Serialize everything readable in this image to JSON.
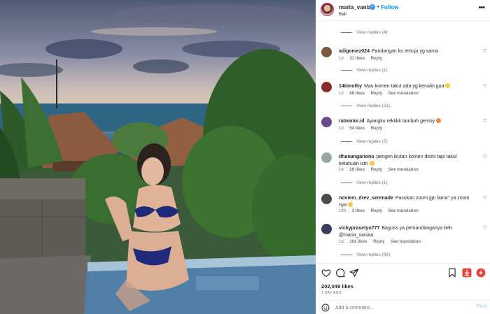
{
  "header": {
    "username": "maria_vaniaa",
    "follow_label": "Follow",
    "location": "Bali",
    "dot": "•",
    "more": "•••"
  },
  "comments": {
    "top_view_replies": "View replies (4)",
    "items": [
      {
        "user": "adigomez024",
        "text": "Pandangan ku tertuju yg sama",
        "time": "1d",
        "likes": "31 likes",
        "reply": "Reply",
        "translate": "",
        "view_replies": "View replies (1)",
        "avatar_color": "#7a5a3c"
      },
      {
        "user": "14timothy",
        "text": "Mau komen takut ada yg kenalin gua",
        "time": "1d",
        "likes": "68 likes",
        "reply": "Reply",
        "translate": "See translation",
        "view_replies": "View replies (21)",
        "avatar_color": "#8b2a2a"
      },
      {
        "user": "ratmotor.id",
        "text": "Ayangku rekkkk tambah gemoy",
        "time": "1d",
        "likes": "54 likes",
        "reply": "Reply",
        "translate": "",
        "view_replies": "View replies (7)",
        "avatar_color": "#6a4c8c"
      },
      {
        "user": "dhanangariono",
        "text": "pengen ikutan komen disini tapi takut ketahuan istri",
        "time": "1d",
        "likes": "29 likes",
        "reply": "Reply",
        "translate": "See translation",
        "view_replies": "View replies (1)",
        "avatar_color": "#9aa7a0"
      },
      {
        "user": "noviem_drev_serenade",
        "text": "Pasukan zoom jgn lama\" ya zoom nya",
        "time": "19h",
        "likes": "3 likes",
        "reply": "Reply",
        "translate": "See translation",
        "view_replies": "",
        "avatar_color": "#4a4a4a"
      },
      {
        "user": "vickyprasetyo777",
        "text": "Baguss ya pemandanganya beb @maria_vaniaa",
        "time": "1d",
        "likes": "102 likes",
        "reply": "Reply",
        "translate": "See translation",
        "view_replies": "View replies (88)",
        "avatar_color": "#3c3c5c"
      }
    ]
  },
  "actions": {
    "likes": "202,049 likes",
    "date": "1 DAY AGO",
    "add_comment_placeholder": "Add a comment...",
    "post_label": "Post"
  },
  "colors": {
    "accent": "#0095f6",
    "post_disabled": "#b2dffc",
    "muted_text": "#737373",
    "download_red": "#e0443a"
  },
  "icons": [
    "heart-icon",
    "comment-icon",
    "share-icon",
    "bookmark-icon",
    "download-icon",
    "emoji-icon"
  ]
}
